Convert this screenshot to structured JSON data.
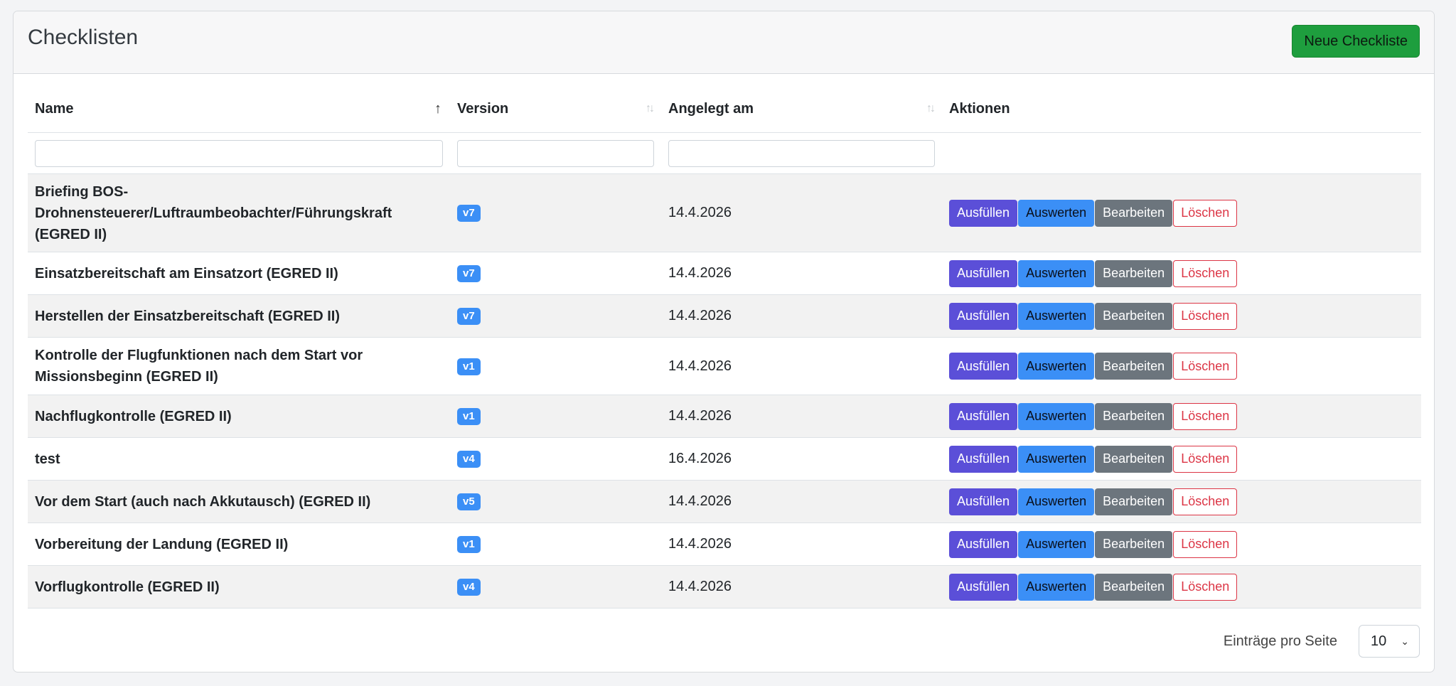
{
  "header": {
    "title": "Checklisten",
    "new_button": "Neue Checkliste"
  },
  "table": {
    "columns": {
      "name": "Name",
      "version": "Version",
      "created": "Angelegt am",
      "actions": "Aktionen"
    },
    "sort_active_icon": "↑",
    "sort_inactive_icon": "↑↓",
    "rows": [
      {
        "name": "Briefing BOS-Drohnensteuerer/Luftraumbeobachter/Führungskraft (EGRED II)",
        "version": "v7",
        "date": "14.4.2026"
      },
      {
        "name": "Einsatzbereitschaft am Einsatzort (EGRED II)",
        "version": "v7",
        "date": "14.4.2026"
      },
      {
        "name": "Herstellen der Einsatzbereitschaft (EGRED II)",
        "version": "v7",
        "date": "14.4.2026"
      },
      {
        "name": "Kontrolle der Flugfunktionen nach dem Start vor Missionsbeginn (EGRED II)",
        "version": "v1",
        "date": "14.4.2026"
      },
      {
        "name": "Nachflugkontrolle (EGRED II)",
        "version": "v1",
        "date": "14.4.2026"
      },
      {
        "name": "test",
        "version": "v4",
        "date": "16.4.2026"
      },
      {
        "name": "Vor dem Start (auch nach Akkutausch) (EGRED II)",
        "version": "v5",
        "date": "14.4.2026"
      },
      {
        "name": "Vorbereitung der Landung (EGRED II)",
        "version": "v1",
        "date": "14.4.2026"
      },
      {
        "name": "Vorflugkontrolle (EGRED II)",
        "version": "v4",
        "date": "14.4.2026"
      }
    ],
    "action_labels": {
      "fill": "Ausfüllen",
      "evaluate": "Auswerten",
      "edit": "Bearbeiten",
      "delete": "Löschen"
    }
  },
  "footer": {
    "per_page_label": "Einträge pro Seite",
    "per_page_value": "10",
    "chevron": "⌄"
  },
  "colors": {
    "primary_green": "#1e9e3e",
    "fill_button": "#5b4fd8",
    "evaluate_button": "#3b8ff6",
    "edit_button": "#6c757d",
    "delete_button": "#dc3545",
    "badge": "#3b8ff6"
  }
}
